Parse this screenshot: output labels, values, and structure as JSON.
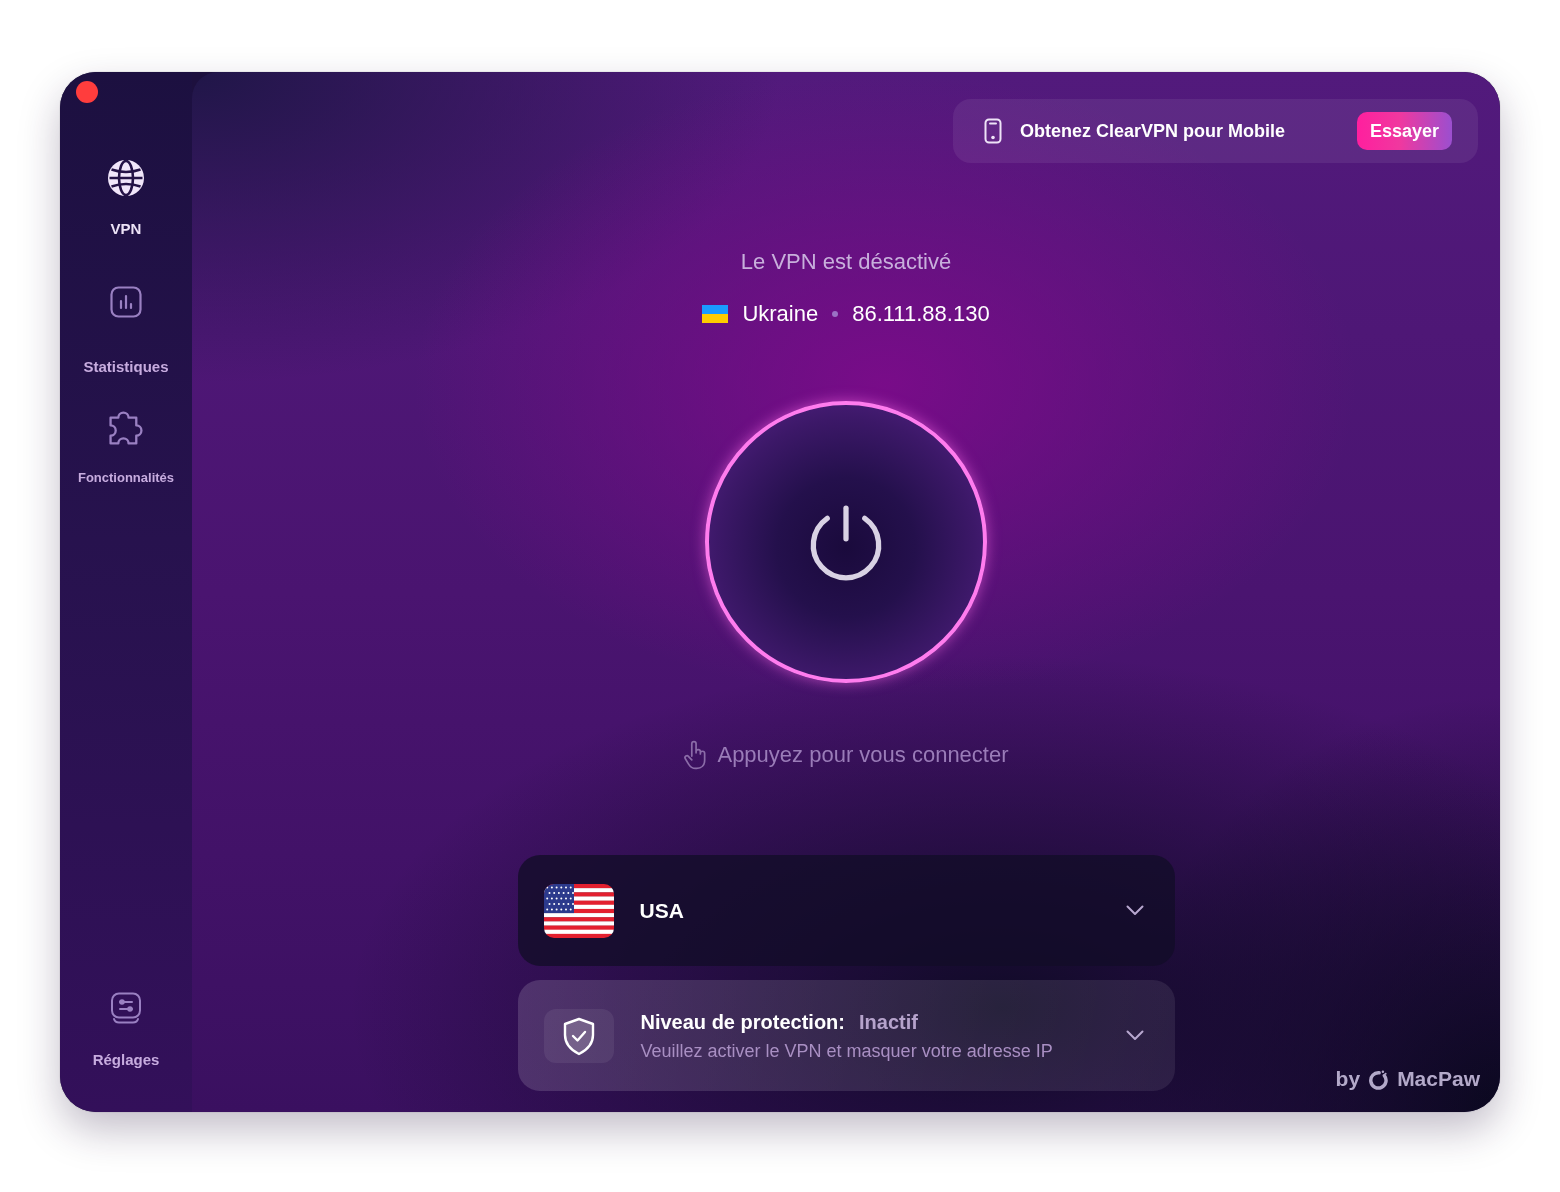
{
  "sidebar": {
    "items": [
      {
        "label": "VPN",
        "selected": true
      },
      {
        "label": "Statistiques",
        "selected": false
      },
      {
        "label": "Fonctionnalités",
        "selected": false
      }
    ],
    "footer_item": {
      "label": "Réglages",
      "selected": false
    }
  },
  "promo_banner": {
    "text": "Obtenez ClearVPN pour Mobile",
    "button": "Essayer"
  },
  "connection": {
    "status": "Le VPN est désactivé",
    "country": "Ukraine",
    "ip": "86.111.88.130",
    "hint": "Appuyez pour vous connecter"
  },
  "location_selector": {
    "country": "USA"
  },
  "protection": {
    "label": "Niveau de protection:",
    "value": "Inactif",
    "description": "Veuillez activer le VPN et masquer votre adresse IP"
  },
  "branding": {
    "prefix": "by",
    "name": "MacPaw"
  }
}
